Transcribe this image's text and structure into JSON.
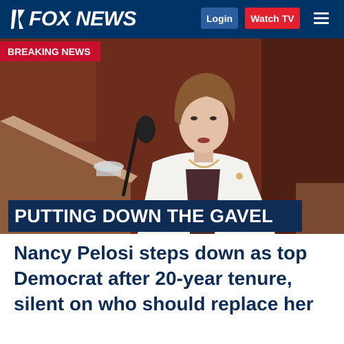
{
  "header": {
    "logo_text": "FOX NEWS",
    "login_label": "Login",
    "watch_label": "Watch TV",
    "colors": {
      "bar": "#003366",
      "login": "#2a5f9e",
      "watch": "#e4202e"
    }
  },
  "hero": {
    "breaking_label": "BREAKING NEWS",
    "kicker": "PUTTING DOWN THE GAVEL",
    "image_subject": "speaker-at-podium-photo"
  },
  "article": {
    "headline": "Nancy Pelosi steps down as top Democrat after 20-year tenure, silent on who should replace her"
  },
  "icons": [
    "fox-logo-icon",
    "hamburger-menu-icon"
  ]
}
